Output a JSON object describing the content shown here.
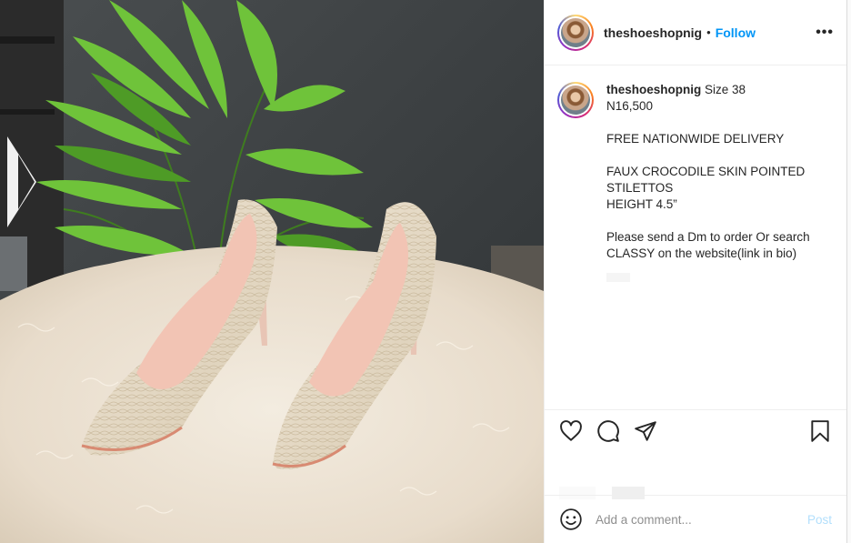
{
  "header": {
    "username": "theshoeshopnig",
    "separator": "•",
    "follow_label": "Follow",
    "more_icon": "more-options-icon",
    "more_label": "•••"
  },
  "caption": {
    "username": "theshoeshopnig",
    "first_line_rest": " Size 38",
    "lines": [
      "N16,500",
      "",
      "FREE NATIONWIDE DELIVERY",
      "",
      "FAUX CROCODILE SKIN POINTED",
      "STILETTOS",
      "HEIGHT 4.5”",
      "",
      "Please send a Dm to order Or search",
      "CLASSY on the website(link in bio)"
    ]
  },
  "actions": {
    "icons": [
      "heart-icon",
      "comment-icon",
      "share-icon",
      "bookmark-icon"
    ]
  },
  "comment_box": {
    "placeholder": "Add a comment...",
    "post_label": "Post"
  },
  "colors": {
    "follow_blue": "#0095f6",
    "post_disabled": "#b2dffc",
    "border": "#efefef"
  }
}
